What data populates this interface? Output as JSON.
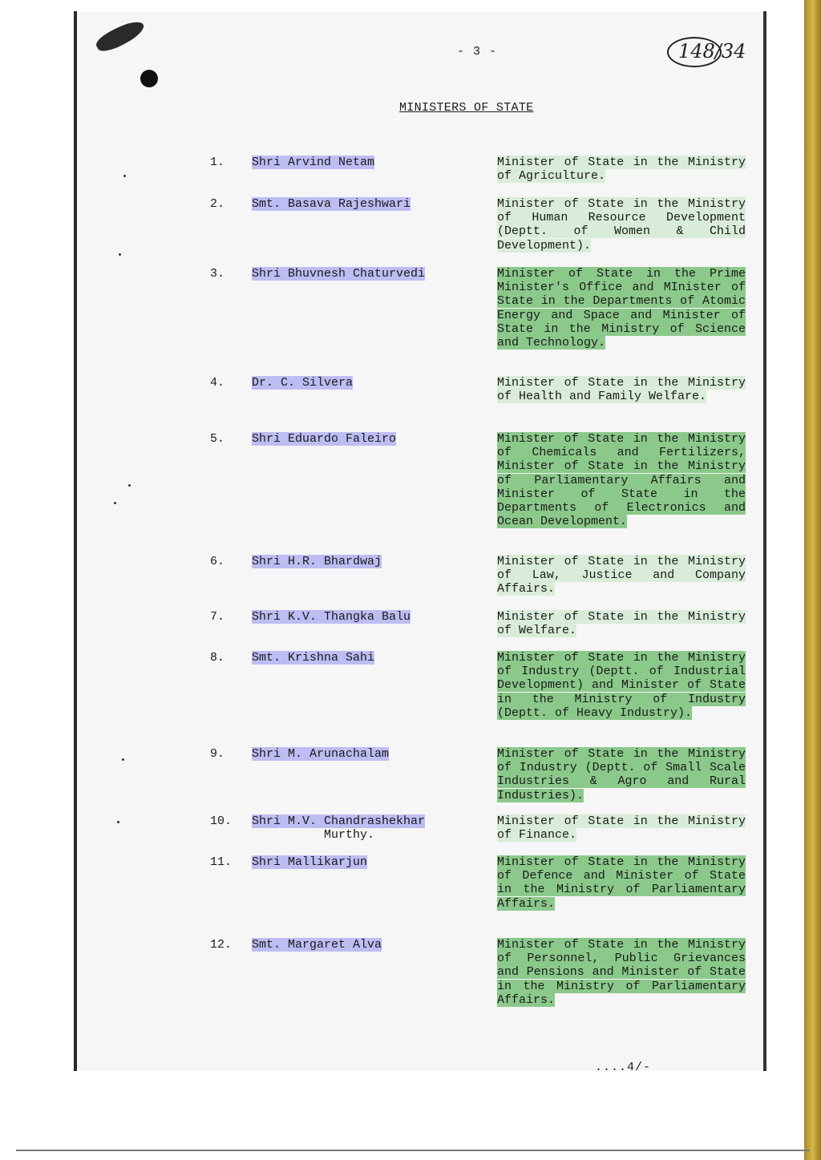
{
  "page": {
    "page_number": "- 3 -",
    "handwritten_mark": "148/34",
    "title": "MINISTERS OF STATE",
    "continuation": "....4/-"
  },
  "entries": [
    {
      "num": "1.",
      "name": "Shri Arvind Netam",
      "name_cont": "",
      "role": "Minister of State in the Ministry of Agriculture."
    },
    {
      "num": "2.",
      "name": "Smt. Basava Rajeshwari",
      "name_cont": "",
      "role": "Minister of State in the Ministry of Human Resource Development (Deptt. of Women & Child Development)."
    },
    {
      "num": "3.",
      "name": "Shri Bhuvnesh Chaturvedi",
      "name_cont": "",
      "role": "Minister of State in the Prime Minister's Office and MInister of State in the Departments of Atomic Energy and Space and Minister of State in the Ministry of Science and Technology."
    },
    {
      "num": "4.",
      "name": "Dr. C. Silvera",
      "name_cont": "",
      "role": "Minister of State in the Ministry of Health and Family Welfare."
    },
    {
      "num": "5.",
      "name": "Shri Eduardo Faleiro",
      "name_cont": "",
      "role": "Minister of State in the Ministry of Chemicals and Fertilizers, Minister of State in the Ministry of Parliamentary Affairs and Minister of State in the Departments of Electronics and Ocean Development."
    },
    {
      "num": "6.",
      "name": "Shri H.R. Bhardwaj",
      "name_cont": "",
      "role": "Minister of State in the Ministry of Law, Justice and Company Affairs."
    },
    {
      "num": "7.",
      "name": "Shri K.V. Thangka Balu",
      "name_cont": "",
      "role": "Minister of State in the Ministry of Welfare."
    },
    {
      "num": "8.",
      "name": "Smt. Krishna Sahi",
      "name_cont": "",
      "role": "Minister of State in the Ministry of Industry (Deptt. of Industrial Development) and Minister of State in the Ministry of Industry (Deptt. of Heavy Industry)."
    },
    {
      "num": "9.",
      "name": "Shri M. Arunachalam",
      "name_cont": "",
      "role": "Minister of State in the Ministry of Industry (Deptt. of Small Scale Industries & Agro and Rural Industries)."
    },
    {
      "num": "10.",
      "name": "Shri M.V. Chandrashekhar",
      "name_cont": "Murthy.",
      "role": "Minister of State in the Ministry of Finance."
    },
    {
      "num": "11.",
      "name": "Shri Mallikarjun",
      "name_cont": "",
      "role": "Minister of State in the Ministry of Defence and Minister of State in the Ministry of Parliamentary Affairs."
    },
    {
      "num": "12.",
      "name": "Smt. Margaret Alva",
      "name_cont": "",
      "role": "Minister of State in the Ministry of Personnel, Public Grievances and Pensions and Minister of State in the Ministry of Parliamentary Affairs."
    }
  ],
  "highlight_colors": {
    "name": "#bdbdf3",
    "role_strong": "#8bc98b",
    "role_light": "#d9ecd9"
  }
}
